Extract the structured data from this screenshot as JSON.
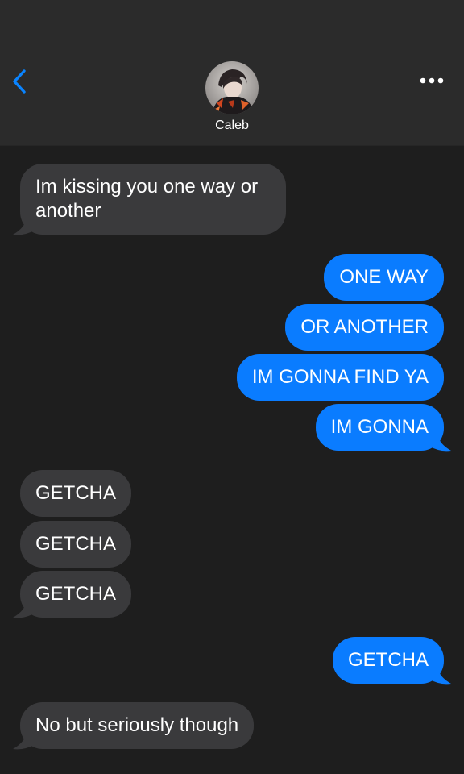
{
  "header": {
    "contact_name": "Caleb",
    "back_icon": "chevron-left-icon",
    "more_icon": "ellipsis-icon"
  },
  "colors": {
    "incoming_bubble": "#3a3a3c",
    "outgoing_bubble": "#0a7cff",
    "background": "#1e1e1e",
    "header_background": "#2b2b2b",
    "accent": "#0a84ff"
  },
  "messages": [
    {
      "direction": "incoming",
      "text": "Im kissing you one way or another"
    },
    {
      "direction": "outgoing",
      "text": "ONE WAY"
    },
    {
      "direction": "outgoing",
      "text": "OR ANOTHER"
    },
    {
      "direction": "outgoing",
      "text": "IM GONNA FIND YA"
    },
    {
      "direction": "outgoing",
      "text": "IM GONNA"
    },
    {
      "direction": "incoming",
      "text": "GETCHA"
    },
    {
      "direction": "incoming",
      "text": "GETCHA"
    },
    {
      "direction": "incoming",
      "text": "GETCHA"
    },
    {
      "direction": "outgoing",
      "text": "GETCHA"
    },
    {
      "direction": "incoming",
      "text": "No but seriously though"
    }
  ]
}
